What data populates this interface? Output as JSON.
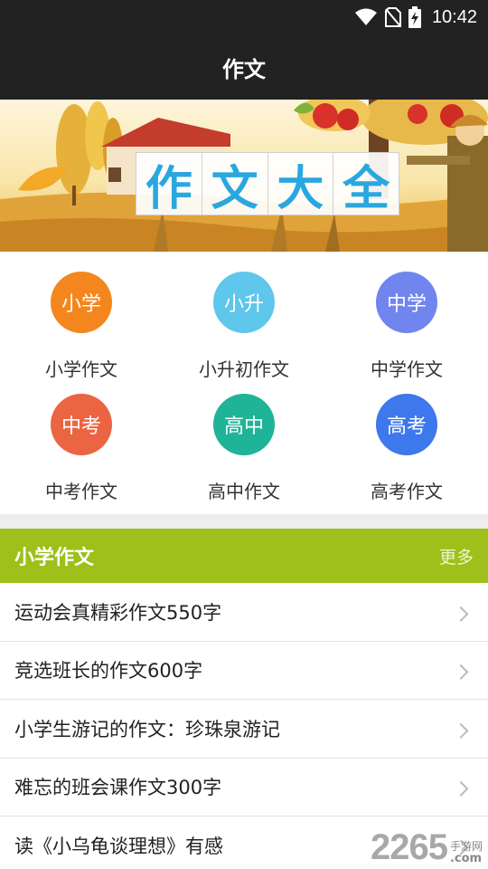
{
  "status_bar": {
    "time": "10:42",
    "icons": [
      "wifi-icon",
      "no-sim-icon",
      "battery-charging-icon"
    ]
  },
  "app_bar": {
    "title": "作文"
  },
  "banner": {
    "title_chars": [
      "作",
      "文",
      "大",
      "全"
    ]
  },
  "categories": [
    {
      "circle_text": "小学",
      "label": "小学作文",
      "color": "#f4861e"
    },
    {
      "circle_text": "小升",
      "label": "小升初作文",
      "color": "#5fc6ec"
    },
    {
      "circle_text": "中学",
      "label": "中学作文",
      "color": "#7185ee"
    },
    {
      "circle_text": "中考",
      "label": "中考作文",
      "color": "#ec6543"
    },
    {
      "circle_text": "高中",
      "label": "高中作文",
      "color": "#1fb397"
    },
    {
      "circle_text": "高考",
      "label": "高考作文",
      "color": "#3d78ec"
    }
  ],
  "section": {
    "title": "小学作文",
    "more_label": "更多",
    "color": "#9dc01a",
    "items": [
      "运动会真精彩作文550字",
      "竞选班长的作文600字",
      "小学生游记的作文：珍珠泉游记",
      "难忘的班会课作文300字",
      "读《小乌龟谈理想》有感"
    ]
  },
  "watermark": {
    "number": "2265",
    "cn": "手游网",
    "domain": ".com"
  }
}
